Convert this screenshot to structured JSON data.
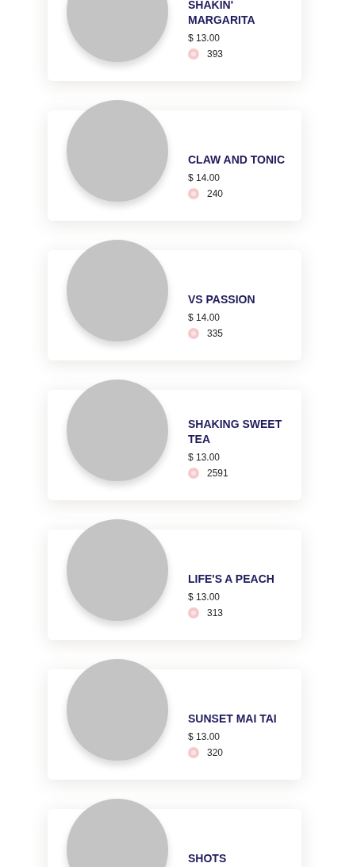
{
  "menu_items": [
    {
      "name": "SHAKIN' MARGARITA",
      "price": "$ 13.00",
      "likes": "393"
    },
    {
      "name": "CLAW AND TONIC",
      "price": "$ 14.00",
      "likes": "240"
    },
    {
      "name": "VS PASSION",
      "price": "$ 14.00",
      "likes": "335"
    },
    {
      "name": "SHAKING SWEET TEA",
      "price": "$ 13.00",
      "likes": "2591"
    },
    {
      "name": "LIFE'S A PEACH",
      "price": "$ 13.00",
      "likes": "313"
    },
    {
      "name": "SUNSET MAI TAI",
      "price": "$ 13.00",
      "likes": "320"
    },
    {
      "name": "SHOTS"
    }
  ]
}
